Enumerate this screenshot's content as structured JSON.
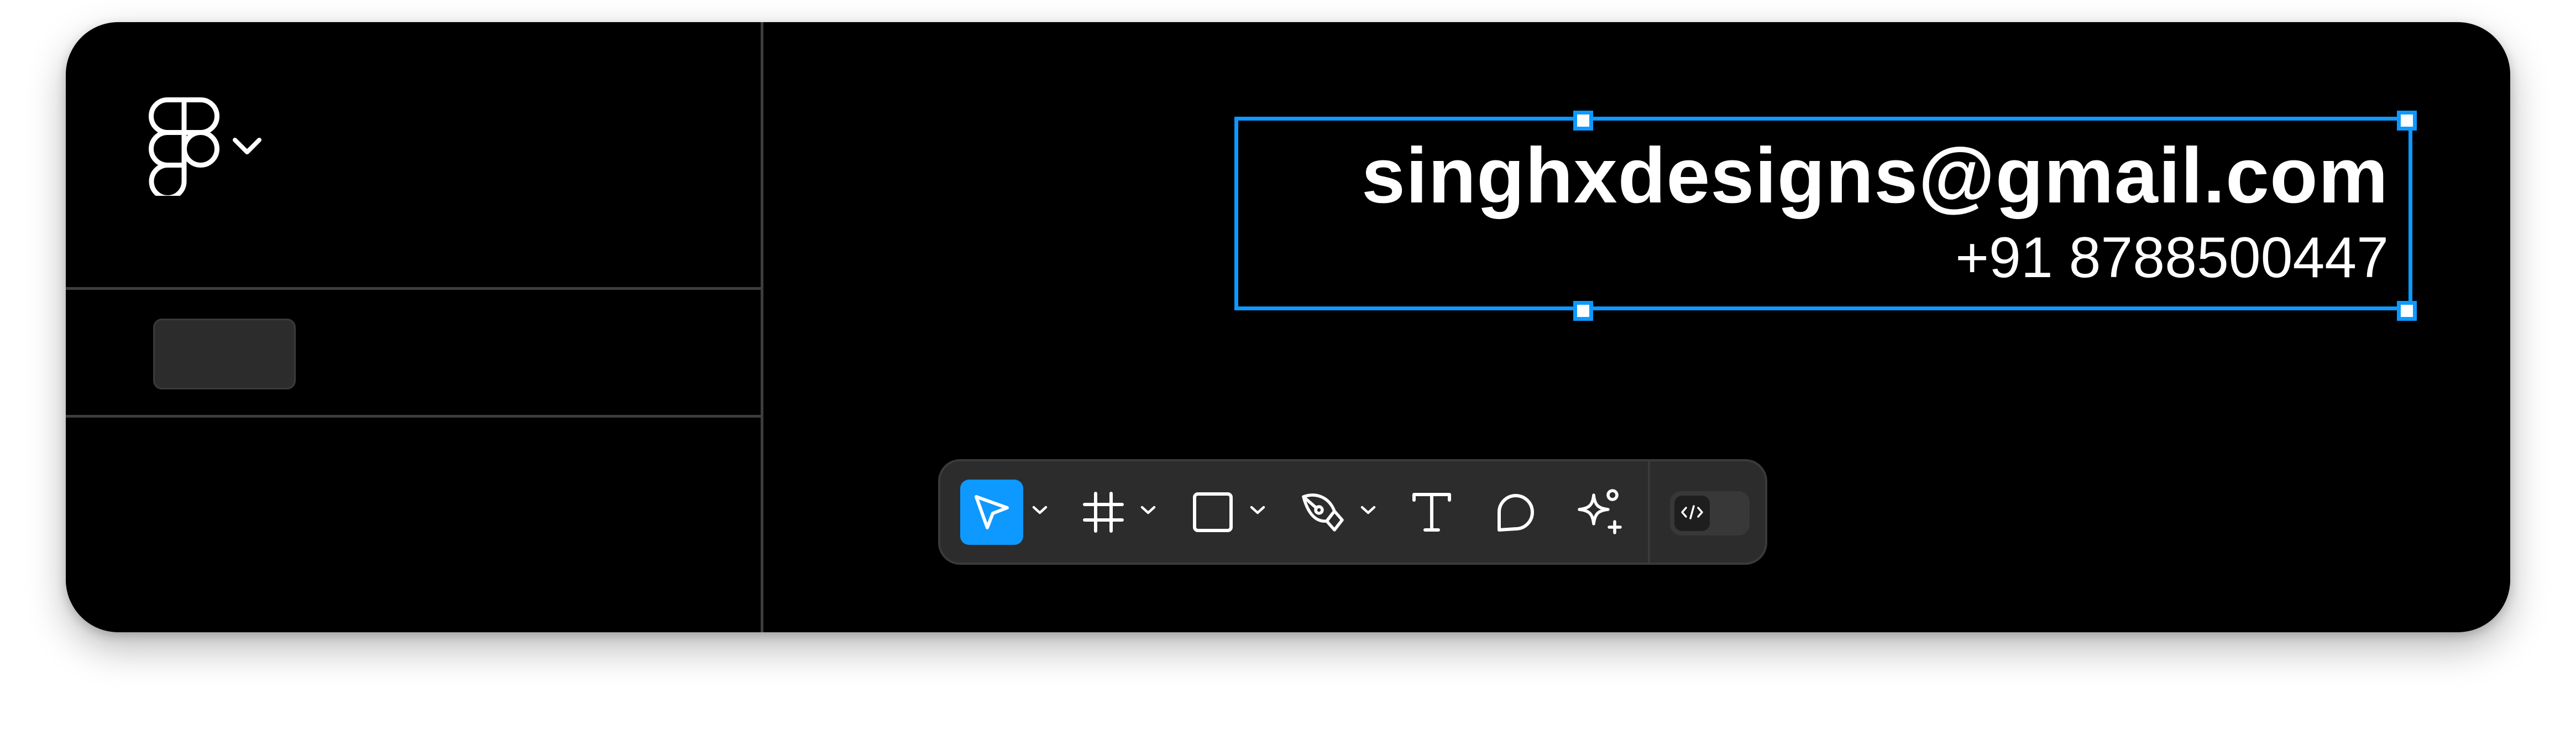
{
  "canvas": {
    "selected_text": {
      "email": "singhxdesigns@gmail.com",
      "phone": "+91 8788500447"
    }
  },
  "toolbar": {
    "tools": [
      {
        "name": "Move",
        "icon": "cursor-arrow-icon",
        "active": true,
        "has_menu": true
      },
      {
        "name": "Frame",
        "icon": "frame-hash-icon",
        "active": false,
        "has_menu": true
      },
      {
        "name": "Rectangle",
        "icon": "rectangle-icon",
        "active": false,
        "has_menu": true
      },
      {
        "name": "Pen",
        "icon": "pen-icon",
        "active": false,
        "has_menu": true
      },
      {
        "name": "Text",
        "icon": "text-icon",
        "active": false,
        "has_menu": false
      },
      {
        "name": "Comment",
        "icon": "comment-icon",
        "active": false,
        "has_menu": false
      },
      {
        "name": "Actions",
        "icon": "sparkle-icon",
        "active": false,
        "has_menu": false
      }
    ],
    "dev_mode": {
      "icon": "code-brackets-icon",
      "enabled": false
    }
  },
  "sidebar": {
    "main_menu_icon": "figma-logo-icon"
  },
  "colors": {
    "selection": "#0d99ff",
    "active_tool": "#0d99ff",
    "window_background": "#000000",
    "toolbar_background": "#2c2c2c"
  }
}
